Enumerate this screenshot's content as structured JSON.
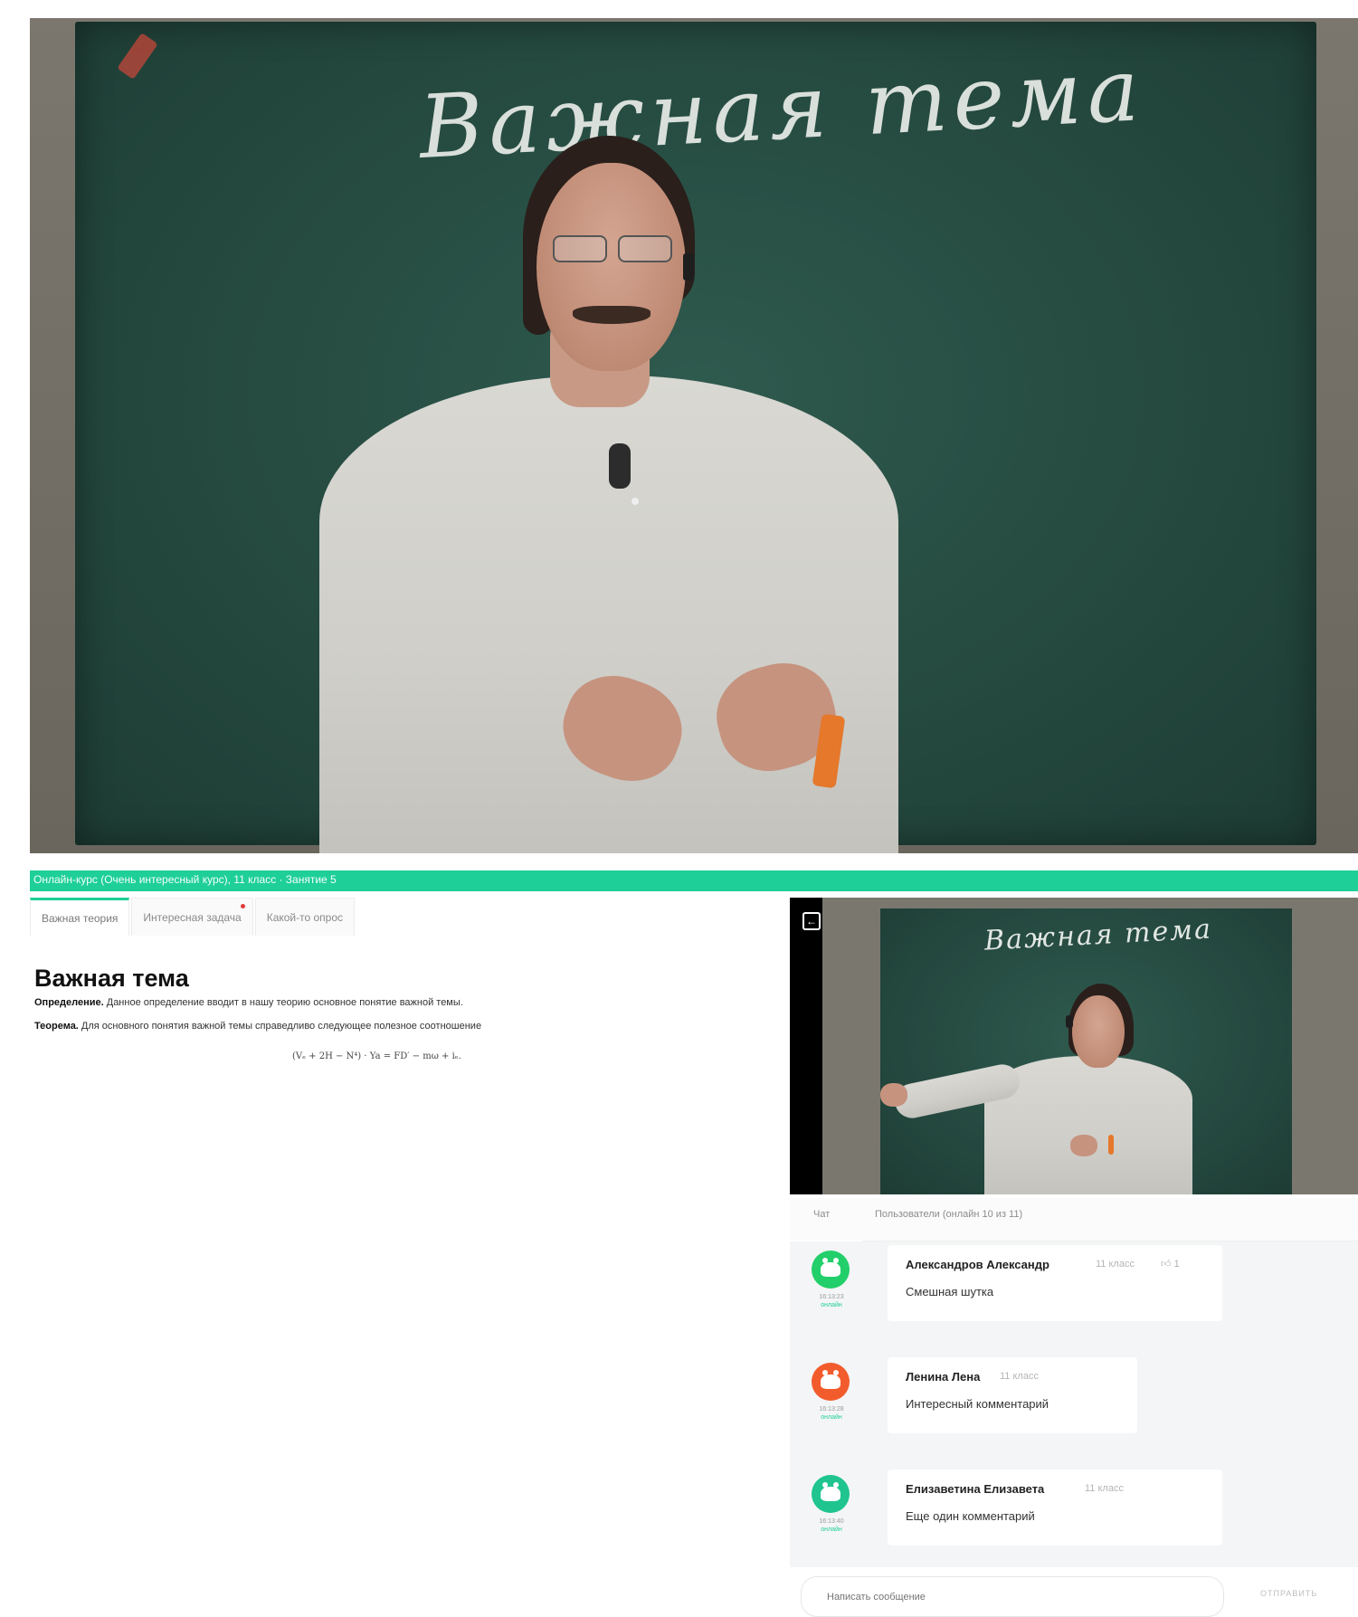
{
  "top_video": {
    "board_text": "Важная тема"
  },
  "app": {
    "course_title": "Онлайн-курс (Очень интересный курс), 11 класс · Занятие 5",
    "tabs": [
      {
        "label": "Важная теория",
        "active": true
      },
      {
        "label": "Интересная задача",
        "has_dot": true
      },
      {
        "label": "Какой-то опрос"
      }
    ],
    "content": {
      "title": "Важная тема",
      "definition_label": "Определение.",
      "definition_text": " Данное определение вводит в нашу теорию основное понятие важной темы.",
      "theorem_label": "Теорема.",
      "theorem_text": " Для основного понятия важной темы справедливо следующее полезное соотношение",
      "formula": "(Vₑ + 2H − N⁴) · Ya = FD′ − mω + iₑ."
    },
    "mini_video": {
      "board_text": "Важная тема"
    },
    "chat": {
      "tab_chat": "Чат",
      "tab_users": "Пользователи (онлайн 10 из 11)",
      "messages": [
        {
          "author": "Александров Александр",
          "grade": "11 класс",
          "likes": "1",
          "text": "Смешная шутка",
          "time": "16:13:23",
          "status": "онлайн",
          "color": "#22cf6a"
        },
        {
          "author": "Ленина Лена",
          "grade": "11 класс",
          "text": "Интересный комментарий",
          "time": "16:13:28",
          "status": "онлайн",
          "color": "#f25c2c"
        },
        {
          "author": "Елизаветина Елизавета",
          "grade": "11 класс",
          "text": "Еще один комментарий",
          "time": "16:13:40",
          "status": "онлайн",
          "color": "#1fc48f"
        }
      ],
      "input_placeholder": "Написать сообщение",
      "send_label": "ОТПРАВИТЬ"
    }
  },
  "colors": {
    "accent": "#1fcf98",
    "board": "#24483e"
  }
}
